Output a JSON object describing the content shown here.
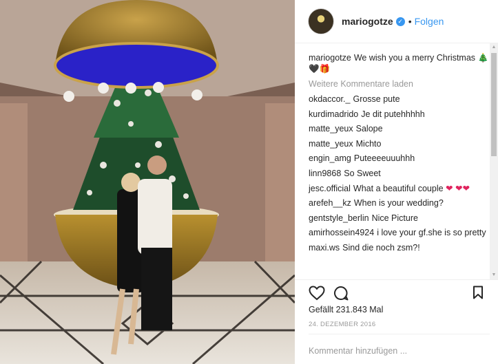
{
  "header": {
    "username": "mariogotze",
    "separator": "•",
    "follow_label": "Folgen",
    "verified_symbol": "✓"
  },
  "caption": {
    "username": "mariogotze",
    "text": "We wish you a merry Christmas",
    "emojis": "🎄🖤🎁"
  },
  "load_more_label": "Weitere Kommentare laden",
  "comments": [
    {
      "user": "okdaccor._",
      "text": "Grosse pute"
    },
    {
      "user": "kurdimadrido",
      "text": "Je dit putehhhhh"
    },
    {
      "user": "matte_yeux",
      "text": "Salope"
    },
    {
      "user": "matte_yeux",
      "text": "Michto"
    },
    {
      "user": "engin_amg",
      "text": "Puteeeeuuuhhh"
    },
    {
      "user": "linn9868",
      "text": "So Sweet"
    },
    {
      "user": "jesc.official",
      "text": "What a beautiful couple",
      "emojis": "❤ ❤❤"
    },
    {
      "user": "arefeh__kz",
      "text": "When is your wedding?"
    },
    {
      "user": "gentstyle_berlin",
      "text": "Nice Picture"
    },
    {
      "user": "amirhossein4924",
      "text": "i love your gf.she is so pretty"
    },
    {
      "user": "maxi.ws",
      "text": "Sind die noch zsm?!"
    }
  ],
  "icons": {
    "like": "heart-outline-icon",
    "comment": "speech-bubble-icon",
    "save": "bookmark-icon"
  },
  "likes_label": "Gefällt 231.843 Mal",
  "date_label": "24. DEZEMBER 2016",
  "comment_input": {
    "placeholder": "Kommentar hinzufügen ..."
  },
  "scrollbar": {
    "up_arrow": "▲",
    "down_arrow": "▼"
  },
  "colors": {
    "link_blue": "#3897f0",
    "text": "#262626",
    "muted": "#999999",
    "border": "#efefef"
  }
}
